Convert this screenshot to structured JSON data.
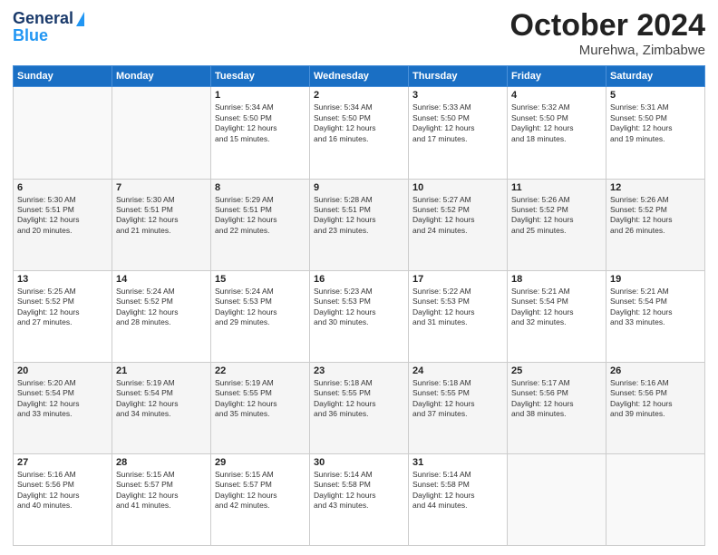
{
  "header": {
    "logo_line1": "General",
    "logo_line2": "Blue",
    "month_year": "October 2024",
    "location": "Murehwa, Zimbabwe"
  },
  "days_of_week": [
    "Sunday",
    "Monday",
    "Tuesday",
    "Wednesday",
    "Thursday",
    "Friday",
    "Saturday"
  ],
  "weeks": [
    [
      {
        "day": "",
        "info": ""
      },
      {
        "day": "",
        "info": ""
      },
      {
        "day": "1",
        "info": "Sunrise: 5:34 AM\nSunset: 5:50 PM\nDaylight: 12 hours\nand 15 minutes."
      },
      {
        "day": "2",
        "info": "Sunrise: 5:34 AM\nSunset: 5:50 PM\nDaylight: 12 hours\nand 16 minutes."
      },
      {
        "day": "3",
        "info": "Sunrise: 5:33 AM\nSunset: 5:50 PM\nDaylight: 12 hours\nand 17 minutes."
      },
      {
        "day": "4",
        "info": "Sunrise: 5:32 AM\nSunset: 5:50 PM\nDaylight: 12 hours\nand 18 minutes."
      },
      {
        "day": "5",
        "info": "Sunrise: 5:31 AM\nSunset: 5:50 PM\nDaylight: 12 hours\nand 19 minutes."
      }
    ],
    [
      {
        "day": "6",
        "info": "Sunrise: 5:30 AM\nSunset: 5:51 PM\nDaylight: 12 hours\nand 20 minutes."
      },
      {
        "day": "7",
        "info": "Sunrise: 5:30 AM\nSunset: 5:51 PM\nDaylight: 12 hours\nand 21 minutes."
      },
      {
        "day": "8",
        "info": "Sunrise: 5:29 AM\nSunset: 5:51 PM\nDaylight: 12 hours\nand 22 minutes."
      },
      {
        "day": "9",
        "info": "Sunrise: 5:28 AM\nSunset: 5:51 PM\nDaylight: 12 hours\nand 23 minutes."
      },
      {
        "day": "10",
        "info": "Sunrise: 5:27 AM\nSunset: 5:52 PM\nDaylight: 12 hours\nand 24 minutes."
      },
      {
        "day": "11",
        "info": "Sunrise: 5:26 AM\nSunset: 5:52 PM\nDaylight: 12 hours\nand 25 minutes."
      },
      {
        "day": "12",
        "info": "Sunrise: 5:26 AM\nSunset: 5:52 PM\nDaylight: 12 hours\nand 26 minutes."
      }
    ],
    [
      {
        "day": "13",
        "info": "Sunrise: 5:25 AM\nSunset: 5:52 PM\nDaylight: 12 hours\nand 27 minutes."
      },
      {
        "day": "14",
        "info": "Sunrise: 5:24 AM\nSunset: 5:52 PM\nDaylight: 12 hours\nand 28 minutes."
      },
      {
        "day": "15",
        "info": "Sunrise: 5:24 AM\nSunset: 5:53 PM\nDaylight: 12 hours\nand 29 minutes."
      },
      {
        "day": "16",
        "info": "Sunrise: 5:23 AM\nSunset: 5:53 PM\nDaylight: 12 hours\nand 30 minutes."
      },
      {
        "day": "17",
        "info": "Sunrise: 5:22 AM\nSunset: 5:53 PM\nDaylight: 12 hours\nand 31 minutes."
      },
      {
        "day": "18",
        "info": "Sunrise: 5:21 AM\nSunset: 5:54 PM\nDaylight: 12 hours\nand 32 minutes."
      },
      {
        "day": "19",
        "info": "Sunrise: 5:21 AM\nSunset: 5:54 PM\nDaylight: 12 hours\nand 33 minutes."
      }
    ],
    [
      {
        "day": "20",
        "info": "Sunrise: 5:20 AM\nSunset: 5:54 PM\nDaylight: 12 hours\nand 33 minutes."
      },
      {
        "day": "21",
        "info": "Sunrise: 5:19 AM\nSunset: 5:54 PM\nDaylight: 12 hours\nand 34 minutes."
      },
      {
        "day": "22",
        "info": "Sunrise: 5:19 AM\nSunset: 5:55 PM\nDaylight: 12 hours\nand 35 minutes."
      },
      {
        "day": "23",
        "info": "Sunrise: 5:18 AM\nSunset: 5:55 PM\nDaylight: 12 hours\nand 36 minutes."
      },
      {
        "day": "24",
        "info": "Sunrise: 5:18 AM\nSunset: 5:55 PM\nDaylight: 12 hours\nand 37 minutes."
      },
      {
        "day": "25",
        "info": "Sunrise: 5:17 AM\nSunset: 5:56 PM\nDaylight: 12 hours\nand 38 minutes."
      },
      {
        "day": "26",
        "info": "Sunrise: 5:16 AM\nSunset: 5:56 PM\nDaylight: 12 hours\nand 39 minutes."
      }
    ],
    [
      {
        "day": "27",
        "info": "Sunrise: 5:16 AM\nSunset: 5:56 PM\nDaylight: 12 hours\nand 40 minutes."
      },
      {
        "day": "28",
        "info": "Sunrise: 5:15 AM\nSunset: 5:57 PM\nDaylight: 12 hours\nand 41 minutes."
      },
      {
        "day": "29",
        "info": "Sunrise: 5:15 AM\nSunset: 5:57 PM\nDaylight: 12 hours\nand 42 minutes."
      },
      {
        "day": "30",
        "info": "Sunrise: 5:14 AM\nSunset: 5:58 PM\nDaylight: 12 hours\nand 43 minutes."
      },
      {
        "day": "31",
        "info": "Sunrise: 5:14 AM\nSunset: 5:58 PM\nDaylight: 12 hours\nand 44 minutes."
      },
      {
        "day": "",
        "info": ""
      },
      {
        "day": "",
        "info": ""
      }
    ]
  ]
}
